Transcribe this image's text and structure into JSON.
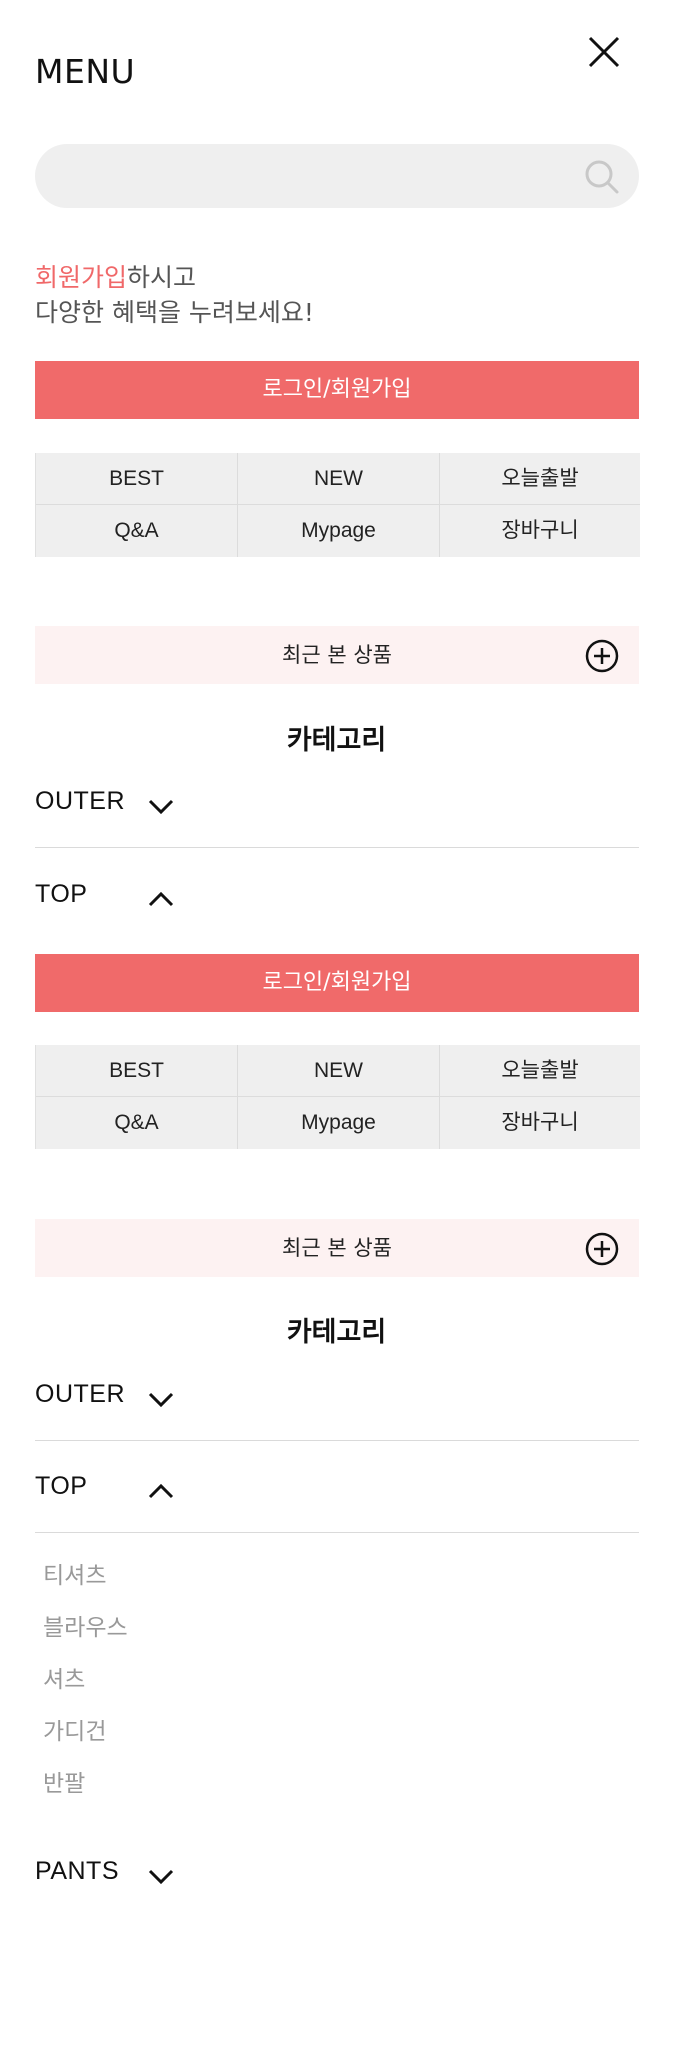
{
  "header": {
    "menu_title": "MENU"
  },
  "search": {
    "placeholder": ""
  },
  "promo": {
    "highlight": "회원가입",
    "line1_rest": "하시고",
    "line2": "다양한 혜택을 누려보세요!"
  },
  "login_button": "로그인/회원가입",
  "quick_links": [
    "BEST",
    "NEW",
    "오늘출발",
    "Q&A",
    "Mypage",
    "장바구니"
  ],
  "recent_products": "최근 본 상품",
  "category_title": "카테고리",
  "categories": {
    "outer": "OUTER",
    "top": "TOP",
    "pants": "PANTS"
  },
  "top_subitems": [
    "티셔츠",
    "블라우스",
    "셔츠",
    "가디건",
    "반팔"
  ],
  "colors": {
    "accent": "#f06a6a",
    "recent_bg": "#fdf2f2",
    "grid_bg": "#efefef"
  },
  "icons": {
    "close": "close-icon",
    "search": "search-icon",
    "plus": "plus-circle-icon",
    "chevron_down": "chevron-down-icon",
    "chevron_up": "chevron-up-icon"
  }
}
